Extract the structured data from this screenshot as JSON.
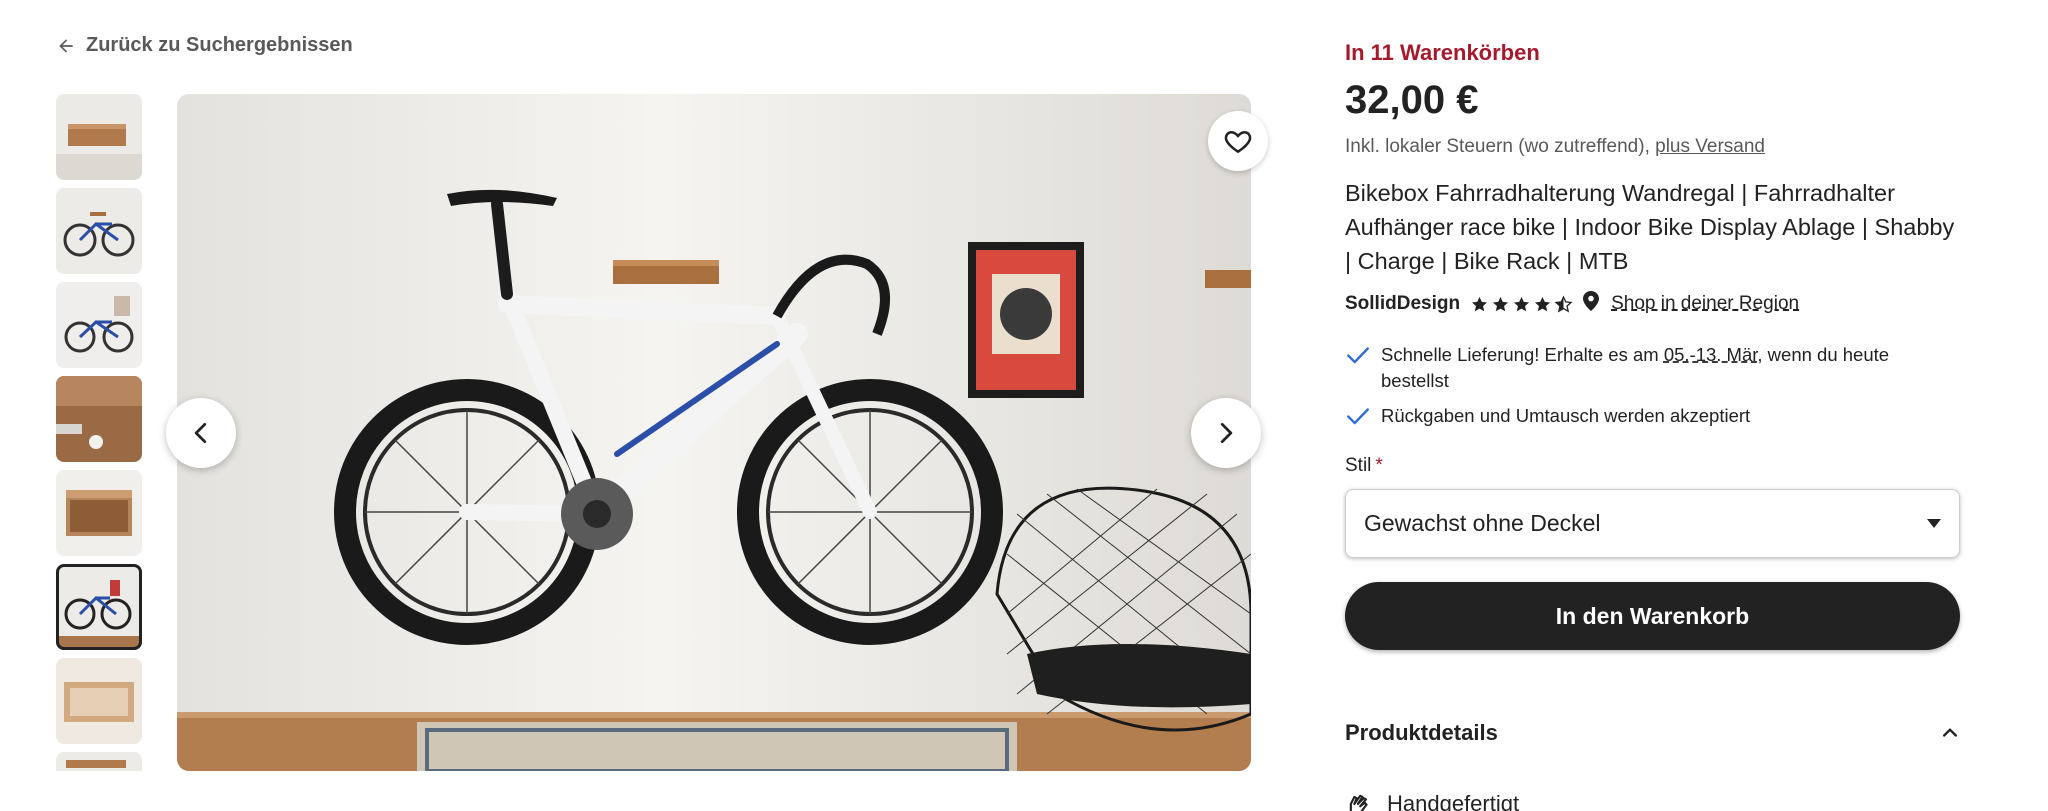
{
  "nav": {
    "back_label": "Zurück zu Suchergebnissen"
  },
  "gallery": {
    "thumbnail_count": 8,
    "active_index": 5,
    "prev_icon": "chevron-left-icon",
    "next_icon": "chevron-right-icon",
    "favorite_icon": "heart-outline-icon"
  },
  "product": {
    "in_carts": "In 11 Warenkörben",
    "price": "32,00 €",
    "tax_note": "Inkl. lokaler Steuern (wo zutreffend), ",
    "shipping_link": "plus Versand",
    "title": "Bikebox Fahrradhalterung Wandregal | Fahrradhalter Aufhänger race bike | Indoor Bike Display Ablage | Shabby | Charge | Bike Rack | MTB"
  },
  "shop": {
    "name": "SollidDesign",
    "rating": 4.5,
    "region_link": "Shop in deiner Region"
  },
  "benefits": {
    "delivery_prefix": "Schnelle Lieferung! Erhalte es am ",
    "delivery_date": "05.-13. Mär",
    "delivery_suffix": ", wenn du heute bestellst",
    "returns": "Rückgaben und Umtausch werden akzeptiert"
  },
  "variant": {
    "label": "Stil",
    "required_mark": "*",
    "selected": "Gewachst ohne Deckel"
  },
  "actions": {
    "add_to_cart": "In den Warenkorb"
  },
  "details": {
    "heading": "Produktdetails",
    "handmade": "Handgefertigt"
  },
  "colors": {
    "accent_red": "#a61a2e",
    "text": "#222222",
    "muted": "#595959",
    "check_blue": "#2e6bd6",
    "button_dark": "#222222"
  }
}
